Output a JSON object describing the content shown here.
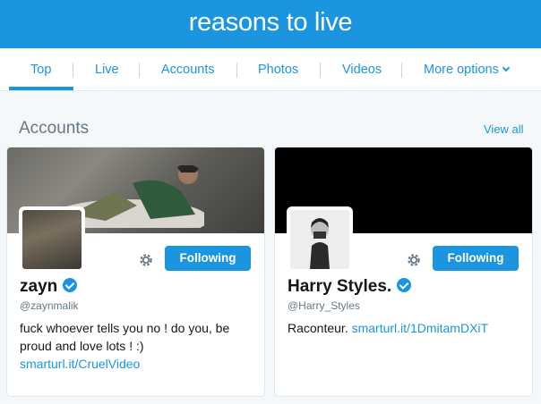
{
  "header": {
    "title": "reasons to live"
  },
  "nav": {
    "tabs": [
      {
        "label": "Top"
      },
      {
        "label": "Live"
      },
      {
        "label": "Accounts"
      },
      {
        "label": "Photos"
      },
      {
        "label": "Videos"
      },
      {
        "label": "More options"
      }
    ],
    "active": "Top"
  },
  "section": {
    "title": "Accounts",
    "view_all": "View all"
  },
  "accounts": [
    {
      "name": "zayn",
      "verified": true,
      "handle": "@zaynmalik",
      "bio_text": "fuck whoever tells you no ! do you, be proud and love lots ! :)",
      "bio_link": "smarturl.it/CruelVideo",
      "button": "Following"
    },
    {
      "name": "Harry Styles.",
      "verified": true,
      "handle": "@Harry_Styles",
      "bio_text": "Raconteur.",
      "bio_link": "smarturl.it/1DmitamDXiT",
      "button": "Following"
    }
  ],
  "colors": {
    "accent": "#1b95e0",
    "muted": "#657786"
  }
}
